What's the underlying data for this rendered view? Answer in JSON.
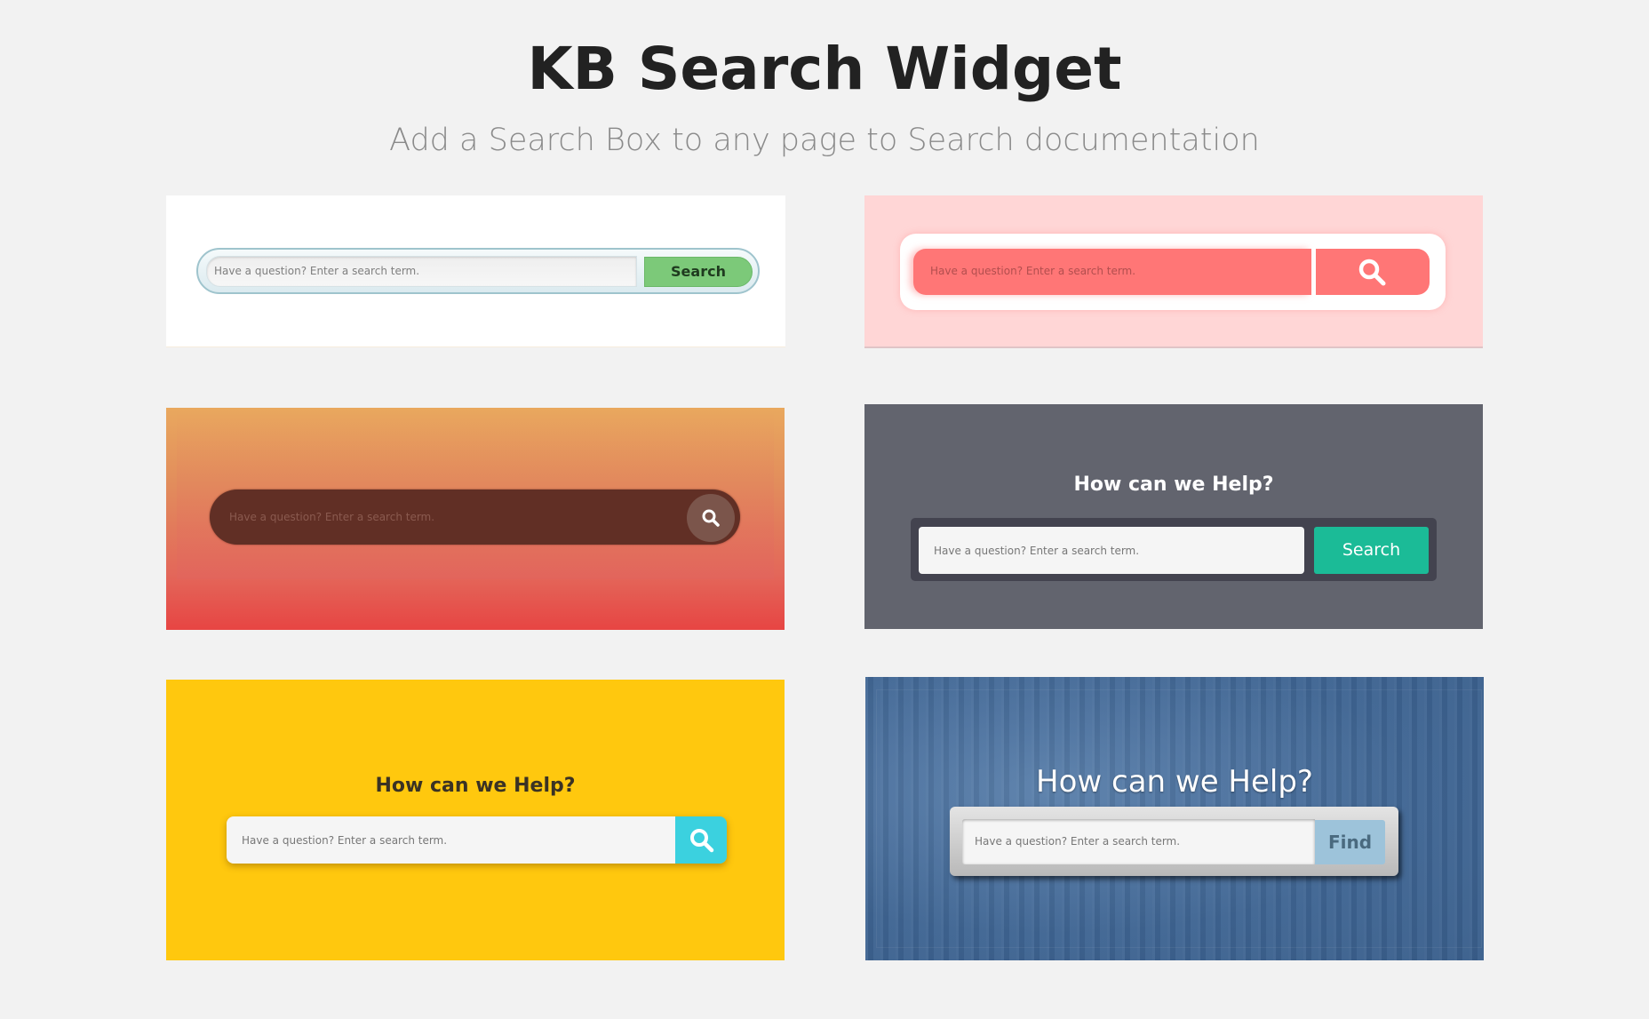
{
  "header": {
    "title": "KB Search Widget",
    "subtitle": "Add a Search Box to any page to Search documentation"
  },
  "widgets": [
    {
      "style": "light-pill-green",
      "placeholder": "Have a question? Enter a search term.",
      "button_label": "Search",
      "button_icon": null,
      "colors": {
        "background": "#ffffff",
        "button": "#7cc979",
        "border": "#9fc4cd"
      }
    },
    {
      "style": "coral-framed",
      "placeholder": "Have a question? Enter a search term.",
      "button_label": null,
      "button_icon": "search-icon",
      "colors": {
        "background": "#ffd6d6",
        "input": "#ff7676",
        "button": "#ff7676"
      }
    },
    {
      "style": "dark-pill-gradient",
      "placeholder": "Have a question? Enter a search term.",
      "button_label": null,
      "button_icon": "search-icon",
      "colors": {
        "background_top": "#e9a85e",
        "background_bottom": "#e74543",
        "pill": "#612f25",
        "button": "#7b554b"
      }
    },
    {
      "style": "slate-teal",
      "heading": "How can we Help?",
      "placeholder": "Have a question? Enter a search term.",
      "button_label": "Search",
      "button_icon": null,
      "colors": {
        "background": "#62646e",
        "frame": "#43434f",
        "button": "#1bbb97"
      }
    },
    {
      "style": "yellow-cyan",
      "heading": "How can we Help?",
      "placeholder": "Have a question? Enter a search term.",
      "button_label": null,
      "button_icon": "search-icon",
      "colors": {
        "background": "#ffc80e",
        "button": "#3bd1df"
      }
    },
    {
      "style": "denim-find",
      "heading": "How can we Help?",
      "placeholder": "Have a question? Enter a search term.",
      "button_label": "Find",
      "button_icon": null,
      "colors": {
        "background": "#3f6593",
        "button": "#9dc3da"
      }
    }
  ]
}
